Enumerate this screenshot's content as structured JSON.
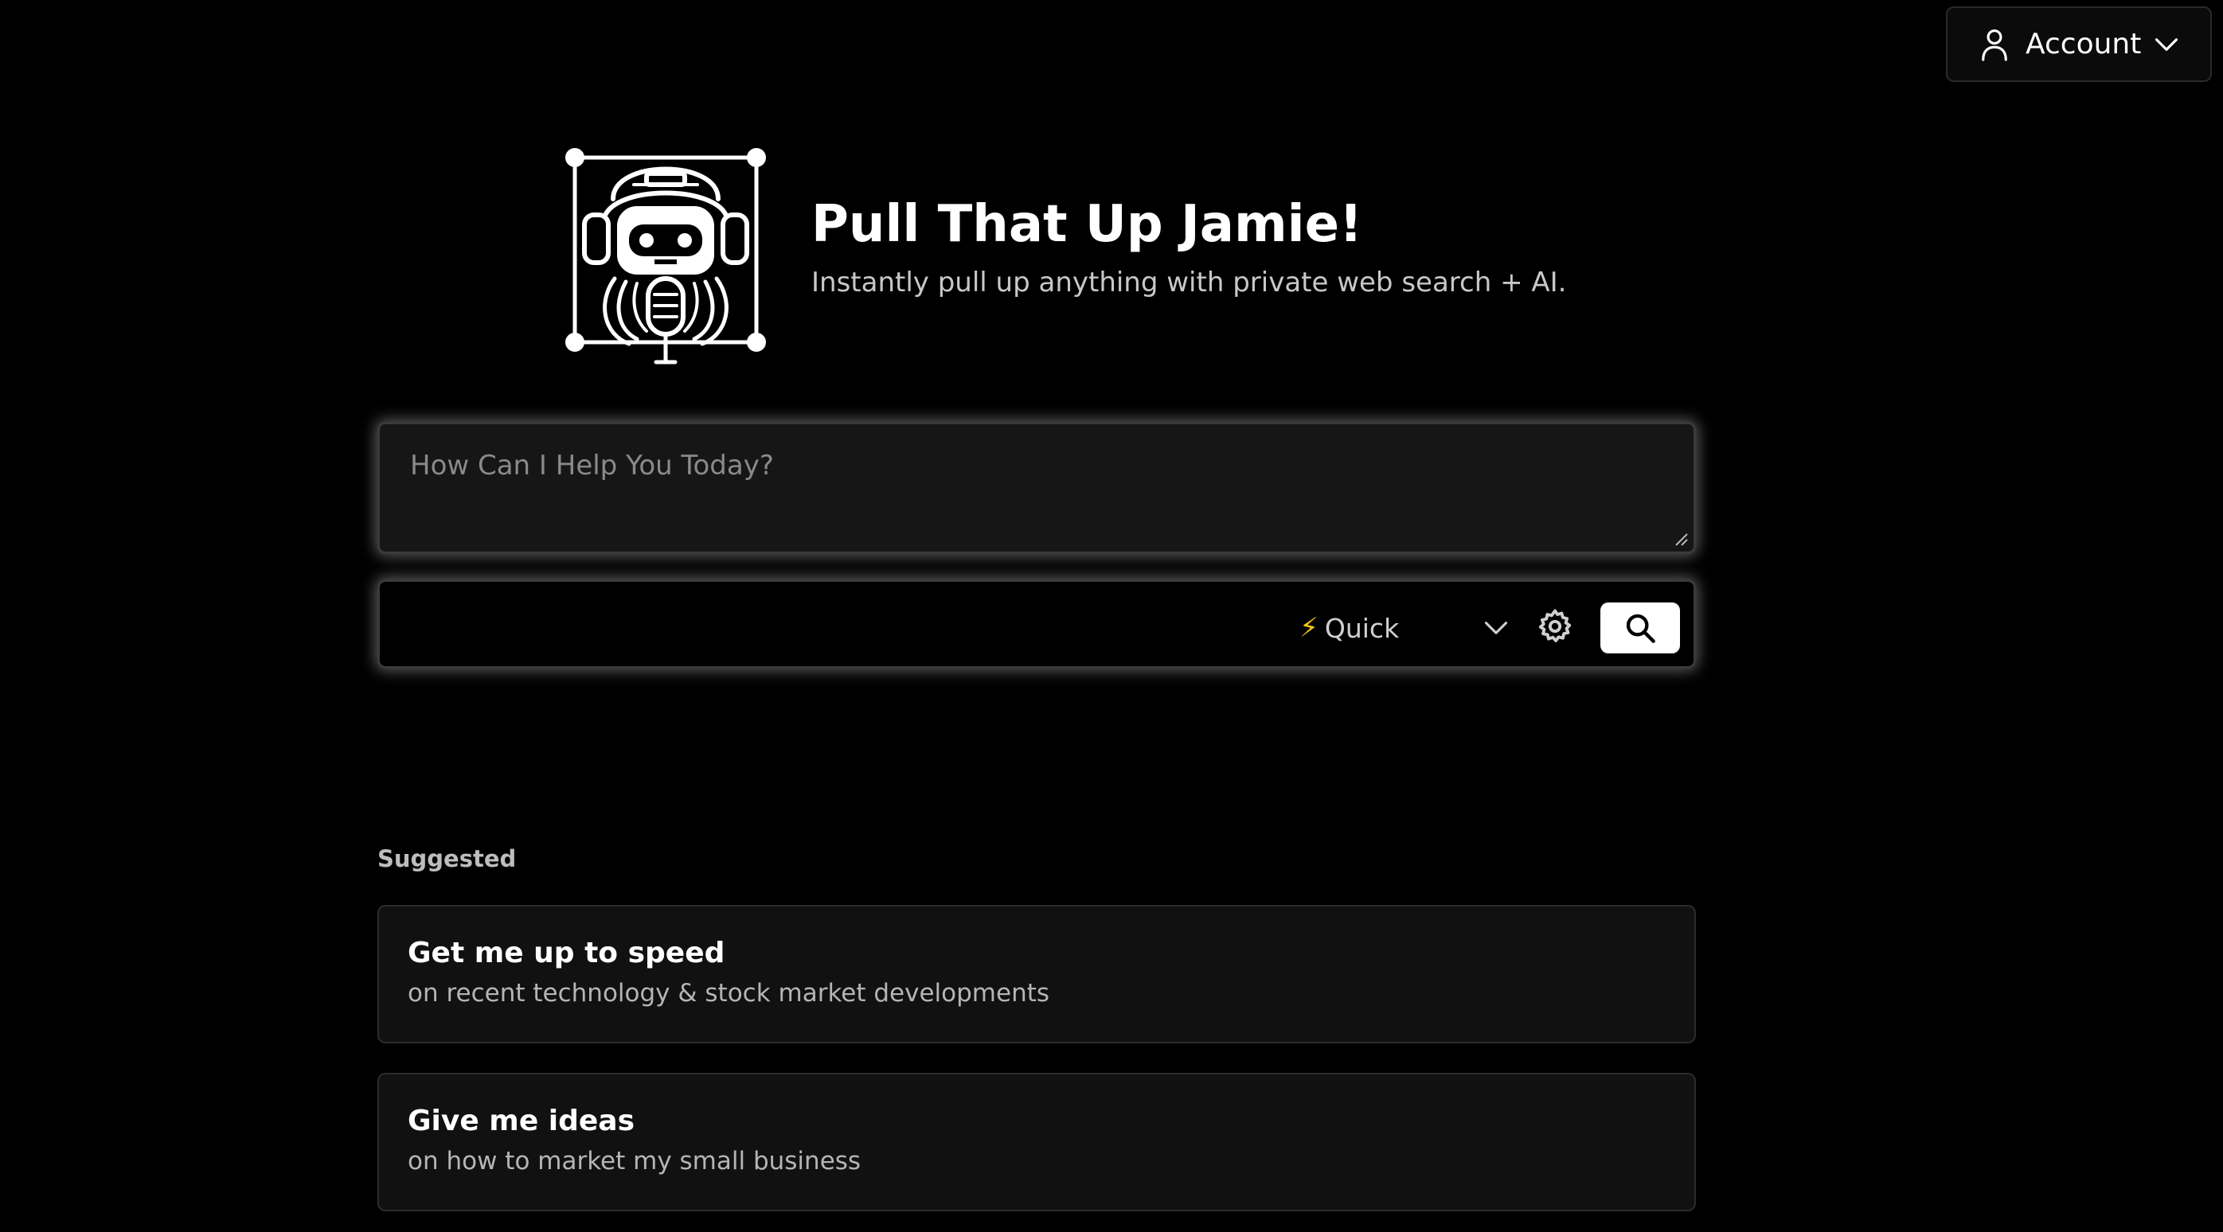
{
  "header": {
    "account_label": "Account",
    "title": "Pull That Up Jamie!",
    "subtitle": "Instantly pull up anything with private web search + AI."
  },
  "search": {
    "placeholder": "How Can I Help You Today?",
    "value": "",
    "mode_label": "Quick",
    "mode_icon": "lightning-bolt-icon"
  },
  "suggested": {
    "heading": "Suggested",
    "items": [
      {
        "title": "Get me up to speed",
        "subtitle": "on recent technology & stock market developments"
      },
      {
        "title": "Give me ideas",
        "subtitle": "on how to market my small business"
      }
    ]
  },
  "colors": {
    "background": "#000000",
    "input_bg": "#161616",
    "card_bg": "#111111",
    "accent": "#ffffff"
  }
}
